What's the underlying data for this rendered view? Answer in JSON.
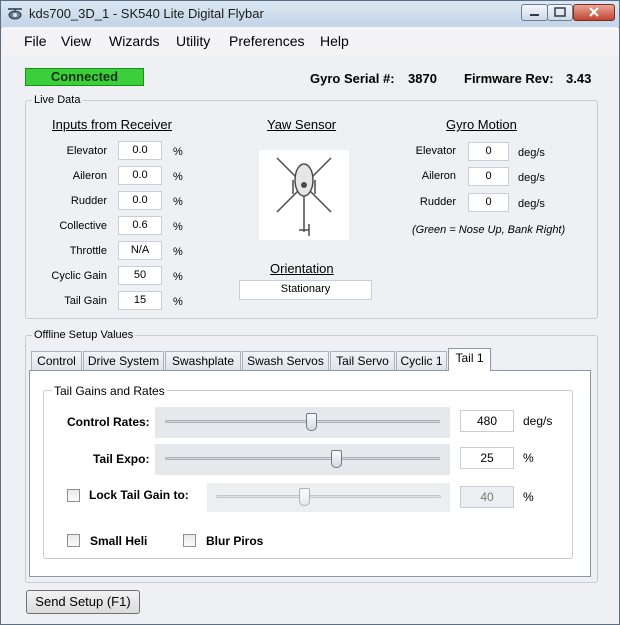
{
  "titlebar": {
    "title": "kds700_3D_1 - SK540 Lite Digital Flybar"
  },
  "menu": [
    "File",
    "View",
    "Wizards",
    "Utility",
    "Preferences",
    "Help"
  ],
  "status": {
    "connection": "Connected",
    "connection_color": "#3bd03b"
  },
  "device": {
    "serial_label": "Gyro Serial #:",
    "serial": "3870",
    "firmware_label": "Firmware Rev:",
    "firmware": "3.43"
  },
  "live": {
    "group_label": "Live Data",
    "inputs_title": "Inputs from Receiver",
    "inputs": [
      {
        "label": "Elevator",
        "value": "0.0",
        "unit": "%"
      },
      {
        "label": "Aileron",
        "value": "0.0",
        "unit": "%"
      },
      {
        "label": "Rudder",
        "value": "0.0",
        "unit": "%"
      },
      {
        "label": "Collective",
        "value": "0.6",
        "unit": "%"
      },
      {
        "label": "Throttle",
        "value": "N/A",
        "unit": "%"
      },
      {
        "label": "Cyclic Gain",
        "value": "50",
        "unit": "%"
      },
      {
        "label": "Tail Gain",
        "value": "15",
        "unit": "%"
      }
    ],
    "yaw_title": "Yaw Sensor",
    "orientation_title": "Orientation",
    "orientation_value": "Stationary",
    "motion_title": "Gyro Motion",
    "motion": [
      {
        "label": "Elevator",
        "value": "0",
        "unit": "deg/s"
      },
      {
        "label": "Aileron",
        "value": "0",
        "unit": "deg/s"
      },
      {
        "label": "Rudder",
        "value": "0",
        "unit": "deg/s"
      }
    ],
    "motion_note": "(Green = Nose Up, Bank Right)"
  },
  "offline": {
    "group_label": "Offline Setup Values",
    "tabs": [
      "Control",
      "Drive System",
      "Swashplate",
      "Swash Servos",
      "Tail Servo",
      "Cyclic 1",
      "Tail 1"
    ],
    "active_tab": "Tail 1",
    "tail": {
      "group_label": "Tail Gains and Rates",
      "control_rates": {
        "label": "Control Rates:",
        "value": "480",
        "unit": "deg/s",
        "position": 0.53
      },
      "tail_expo": {
        "label": "Tail Expo:",
        "value": "25",
        "unit": "%",
        "position": 0.62
      },
      "lock_gain": {
        "label": "Lock Tail Gain to:",
        "value": "40",
        "unit": "%",
        "position": 0.39,
        "checked": false
      },
      "small_heli": {
        "label": "Small Heli",
        "checked": false
      },
      "blur_piros": {
        "label": "Blur Piros",
        "checked": false
      }
    }
  },
  "footer": {
    "send_setup_label": "Send Setup (F1)"
  }
}
